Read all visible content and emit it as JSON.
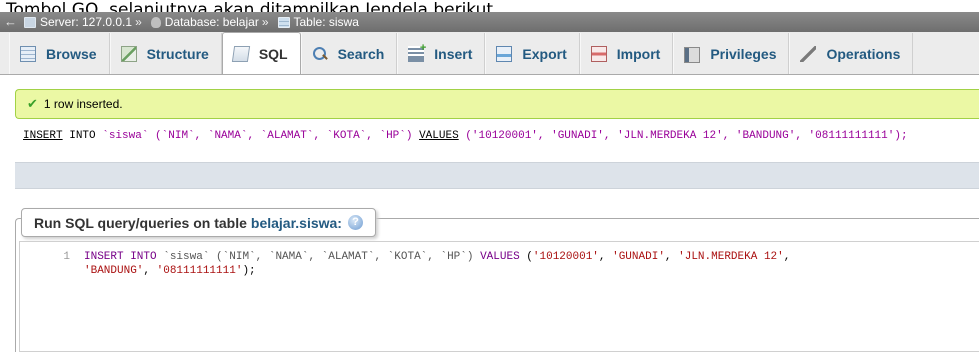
{
  "caption": "Tombol GO, selanjutnya akan ditampilkan Jendela berikut",
  "breadcrumb": {
    "back": "←",
    "server": "Server: 127.0.0.1",
    "database": "Database: belajar",
    "table": "Table: siswa",
    "separator": "»"
  },
  "tabs": [
    {
      "label": "Browse",
      "icon": "browse-icon"
    },
    {
      "label": "Structure",
      "icon": "structure-icon"
    },
    {
      "label": "SQL",
      "icon": "sql-icon",
      "active": true
    },
    {
      "label": "Search",
      "icon": "search-icon"
    },
    {
      "label": "Insert",
      "icon": "insert-icon"
    },
    {
      "label": "Export",
      "icon": "export-icon"
    },
    {
      "label": "Import",
      "icon": "import-icon"
    },
    {
      "label": "Privileges",
      "icon": "privileges-icon"
    },
    {
      "label": "Operations",
      "icon": "operations-icon"
    }
  ],
  "message": {
    "text": "1 row inserted.",
    "icon": "check-icon",
    "color": "#ebf8a4"
  },
  "executed_sql": {
    "insert": "INSERT",
    "into": "INTO",
    "table_part": " `siswa` (`NIM`, `NAMA`, `ALAMAT`, `KOTA`, `HP`) ",
    "values_kw": "VALUES",
    "values_part": " ('10120001', 'GUNADI', 'JLN.MERDEKA 12', 'BANDUNG', '08111111111');"
  },
  "query_box": {
    "legend_prefix": "Run SQL query/queries on table",
    "legend_table": "belajar.siswa:",
    "help_icon": "help-icon",
    "line_number": "1",
    "line1": {
      "kw1": "INSERT INTO",
      "ident": " `siswa` (`NIM`, `NAMA`, `ALAMAT`, `KOTA`, `HP`) ",
      "kw2": "VALUES",
      "open": " (",
      "v1": "'10120001'",
      "c1": ", ",
      "v2": "'GUNADI'",
      "c2": ", ",
      "v3": "'JLN.MERDEKA 12'",
      "c3": ","
    },
    "line2": {
      "v4": "'BANDUNG'",
      "c4": ", ",
      "v5": "'08111111111'",
      "close": ");"
    }
  },
  "colors": {
    "link": "#235a81",
    "keyword": "#990099",
    "string": "#008000",
    "success_border": "#a2d246"
  }
}
